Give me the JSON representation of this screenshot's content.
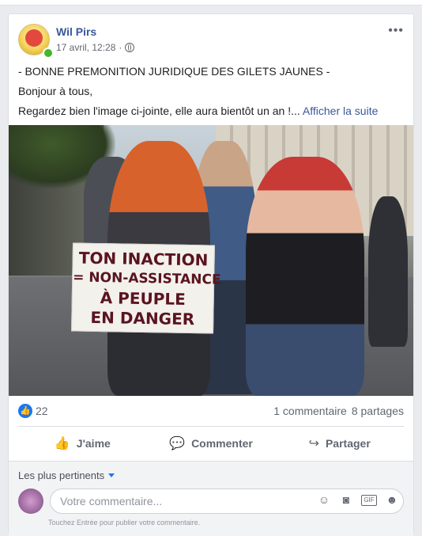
{
  "post": {
    "author": "Wil Pirs",
    "timestamp": "17 avril, 12:28",
    "more_label": "•••",
    "text_line1": "- BONNE PREMONITION JURIDIQUE DES GILETS JAUNES -",
    "text_line2": "Bonjour à tous,",
    "text_line3": "Regardez bien l'image ci-jointe, elle aura bientôt un an !...",
    "see_more": "Afficher la suite",
    "photo_sign": {
      "line1": "TON INACTION",
      "line2": "= NON-ASSISTANCE",
      "line3": "À PEUPLE",
      "line4": "EN DANGER"
    }
  },
  "stats": {
    "likes": "22",
    "comments": "1 commentaire",
    "shares": "8 partages"
  },
  "actions": {
    "like": "J'aime",
    "comment": "Commenter",
    "share": "Partager"
  },
  "comments_section": {
    "sort_label": "Les plus pertinents",
    "input_placeholder": "Votre commentaire...",
    "gif_label": "GIF",
    "hint": "Touchez Entrée pour publier votre commentaire."
  },
  "colors": {
    "link": "#385898",
    "like_blue": "#1877f2",
    "online": "#42b72a"
  },
  "icons": [
    "globe-icon",
    "like-icon",
    "comment-icon",
    "share-icon",
    "emoji-icon",
    "camera-icon",
    "gif-icon",
    "sticker-icon"
  ]
}
